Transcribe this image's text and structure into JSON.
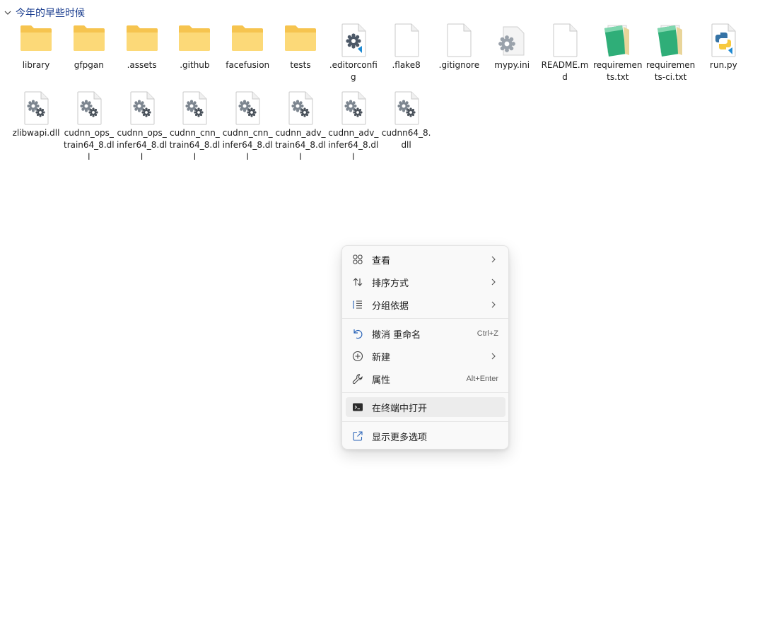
{
  "group": {
    "title": "今年的早些时候"
  },
  "files": [
    {
      "label": "library",
      "icon": "folder-icon",
      "overlay": "doc"
    },
    {
      "label": "gfpgan",
      "icon": "folder-icon",
      "overlay": ""
    },
    {
      "label": ".assets",
      "icon": "folder-icon",
      "overlay": ""
    },
    {
      "label": ".github",
      "icon": "folder-icon",
      "overlay": "doc"
    },
    {
      "label": "facefusion",
      "icon": "folder-icon",
      "overlay": "python"
    },
    {
      "label": "tests",
      "icon": "folder-icon",
      "overlay": "python"
    },
    {
      "label": ".editorconfig",
      "icon": "config-file-icon"
    },
    {
      "label": ".flake8",
      "icon": "blank-file-icon"
    },
    {
      "label": ".gitignore",
      "icon": "blank-file-icon"
    },
    {
      "label": "mypy.ini",
      "icon": "settings-file-icon"
    },
    {
      "label": "README.md",
      "icon": "blank-file-icon"
    },
    {
      "label": "requirements.txt",
      "icon": "notepad-icon"
    },
    {
      "label": "requirements-ci.txt",
      "icon": "notepad-icon"
    },
    {
      "label": "run.py",
      "icon": "python-file-icon"
    },
    {
      "label": "zlibwapi.dll",
      "icon": "dll-file-icon"
    },
    {
      "label": "cudnn_ops_train64_8.dll",
      "icon": "dll-file-icon"
    },
    {
      "label": "cudnn_ops_infer64_8.dll",
      "icon": "dll-file-icon"
    },
    {
      "label": "cudnn_cnn_train64_8.dll",
      "icon": "dll-file-icon"
    },
    {
      "label": "cudnn_cnn_infer64_8.dll",
      "icon": "dll-file-icon"
    },
    {
      "label": "cudnn_adv_train64_8.dll",
      "icon": "dll-file-icon"
    },
    {
      "label": "cudnn_adv_infer64_8.dll",
      "icon": "dll-file-icon"
    },
    {
      "label": "cudnn64_8.dll",
      "icon": "dll-file-icon"
    }
  ],
  "context_menu": {
    "items": [
      {
        "label": "查看",
        "icon": "grid-view-icon",
        "shortcut": "",
        "submenu": true
      },
      {
        "label": "排序方式",
        "icon": "sort-icon",
        "shortcut": "",
        "submenu": true
      },
      {
        "label": "分组依据",
        "icon": "group-list-icon",
        "shortcut": "",
        "submenu": true
      },
      {
        "label": "撤消 重命名",
        "icon": "undo-icon",
        "shortcut": "Ctrl+Z",
        "submenu": false
      },
      {
        "label": "新建",
        "icon": "add-circle-icon",
        "shortcut": "",
        "submenu": true
      },
      {
        "label": "属性",
        "icon": "wrench-icon",
        "shortcut": "Alt+Enter",
        "submenu": false
      },
      {
        "label": "在终端中打开",
        "icon": "terminal-icon",
        "shortcut": "",
        "submenu": false
      },
      {
        "label": "显示更多选项",
        "icon": "open-external-icon",
        "shortcut": "",
        "submenu": false
      }
    ],
    "hovered": "在终端中打开"
  },
  "colors": {
    "folder": "#f6c44f",
    "folder_front": "#fcd978",
    "accent": "#1a3d8f",
    "menu_bg": "#f9f9f9"
  }
}
